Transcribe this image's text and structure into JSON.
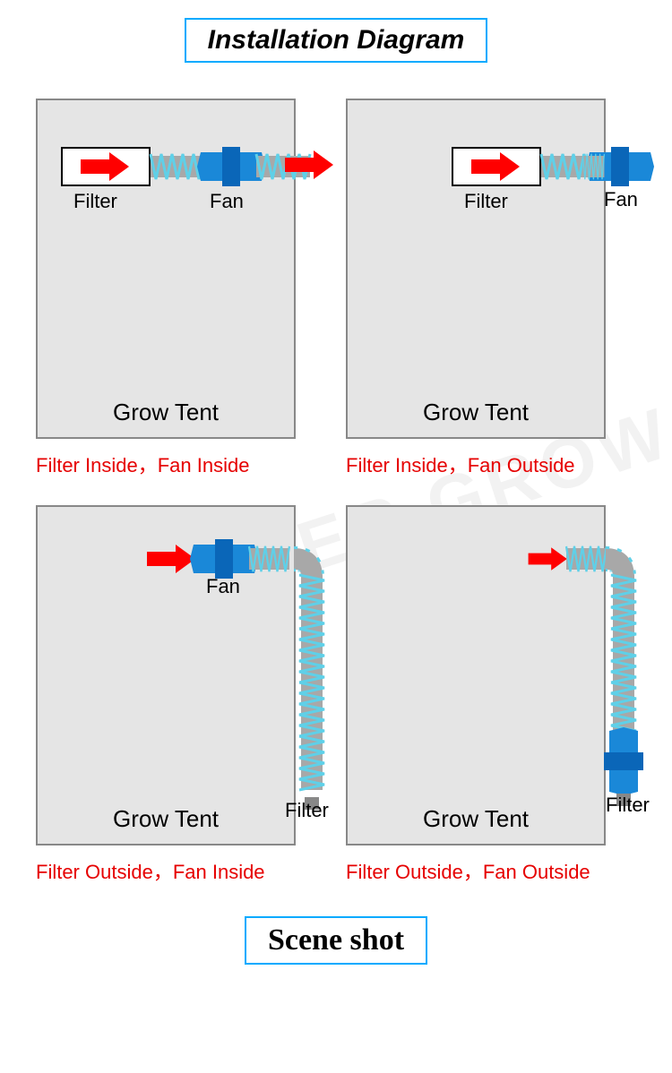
{
  "title": "Installation Diagram",
  "scene_title": "Scene shot",
  "watermark": "MASTER GROW",
  "labels": {
    "filter": "Filter",
    "fan": "Fan",
    "grow_tent": "Grow Tent"
  },
  "configs": [
    {
      "caption": "Filter Inside，Fan Inside"
    },
    {
      "caption": "Filter Inside，Fan Outside"
    },
    {
      "caption": "Filter Outside，Fan Inside"
    },
    {
      "caption": "Filter Outside，Fan Outside"
    }
  ]
}
